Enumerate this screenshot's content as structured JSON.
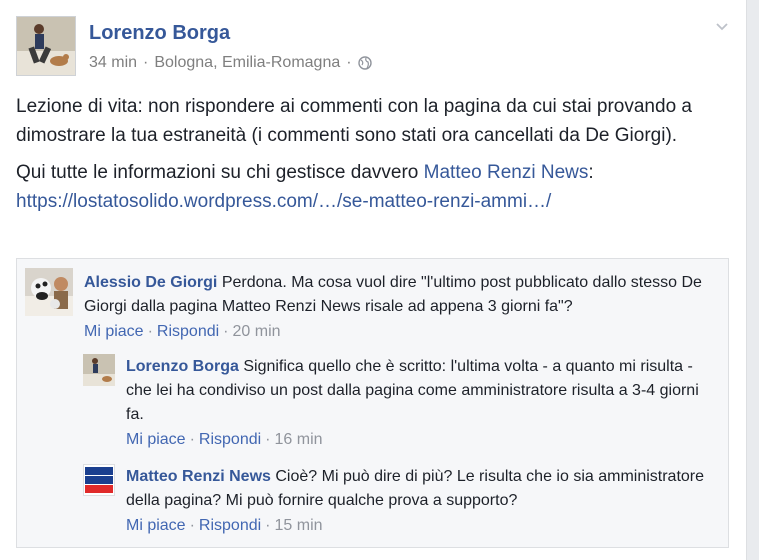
{
  "post": {
    "author": "Lorenzo Borga",
    "time": "34 min",
    "location": "Bologna, Emilia-Romagna",
    "privacy_icon": "globe-icon",
    "menu_icon": "chevron-down-icon",
    "paragraph1": "Lezione di vita: non rispondere ai commenti con la pagina da cui stai provando a dimostrare la tua estraneità (i commenti sono stati ora cancellati da De Giorgi).",
    "paragraph2_prefix": "Qui tutte le informazioni su chi gestisce davvero ",
    "paragraph2_page_link": "Matteo Renzi News",
    "paragraph2_suffix": ":",
    "url": "https://lostatosolido.wordpress.com/…/se-matteo-renzi-ammi…/"
  },
  "comments": [
    {
      "author": "Alessio De Giorgi",
      "text": "Perdona. Ma cosa vuol dire \"l'ultimo post pubblicato dallo stesso De Giorgi dalla pagina Matteo Renzi News risale ad appena 3 giorni fa\"?",
      "like": "Mi piace",
      "reply": "Rispondi",
      "time": "20 min"
    },
    {
      "author": "Lorenzo Borga",
      "text": "Significa quello che è scritto: l'ultima volta - a quanto mi risulta - che lei ha condiviso un post dalla pagina come amministratore risulta a 3-4 giorni fa.",
      "like": "Mi piace",
      "reply": "Rispondi",
      "time": "16 min"
    },
    {
      "author": "Matteo Renzi News",
      "text": "Cioè? Mi può dire di più? Le risulta che io sia amministratore della pagina? Mi può fornire qualche prova a supporto?",
      "like": "Mi piace",
      "reply": "Rispondi",
      "time": "15 min",
      "avatar_text": [
        "MATTEO",
        "RENZI",
        "NEWS"
      ]
    }
  ],
  "separator": "·",
  "colors": {
    "link": "#365899",
    "action": "#4267b2",
    "muted": "#90949c",
    "news_red": "#e02a2a",
    "news_blue": "#1a3f8f"
  }
}
